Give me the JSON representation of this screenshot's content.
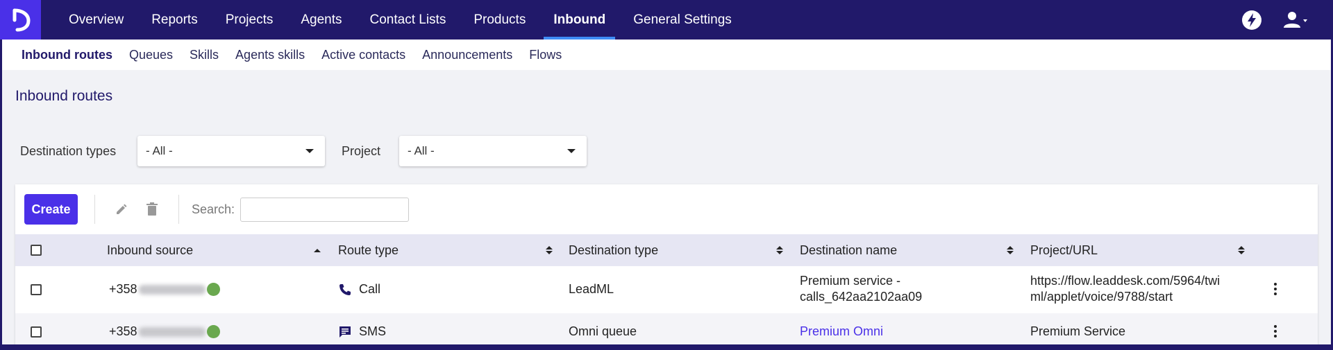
{
  "nav": {
    "logo_icon": "leaddesk-logo-icon",
    "items": [
      {
        "label": "Overview",
        "active": false
      },
      {
        "label": "Reports",
        "active": false
      },
      {
        "label": "Projects",
        "active": false
      },
      {
        "label": "Agents",
        "active": false
      },
      {
        "label": "Contact Lists",
        "active": false
      },
      {
        "label": "Products",
        "active": false
      },
      {
        "label": "Inbound",
        "active": true
      },
      {
        "label": "General Settings",
        "active": false
      }
    ],
    "right_icons": [
      "lightning-icon",
      "user-account-icon"
    ]
  },
  "subnav": {
    "items": [
      {
        "label": "Inbound routes",
        "active": true
      },
      {
        "label": "Queues",
        "active": false
      },
      {
        "label": "Skills",
        "active": false
      },
      {
        "label": "Agents skills",
        "active": false
      },
      {
        "label": "Active contacts",
        "active": false
      },
      {
        "label": "Announcements",
        "active": false
      },
      {
        "label": "Flows",
        "active": false
      }
    ]
  },
  "page": {
    "title": "Inbound routes"
  },
  "filters": {
    "destination_types": {
      "label": "Destination types",
      "value": "- All -"
    },
    "project": {
      "label": "Project",
      "value": "- All -"
    }
  },
  "toolbar": {
    "create_label": "Create",
    "search_label": "Search:",
    "search_value": ""
  },
  "table": {
    "columns": [
      {
        "label": "Inbound source",
        "sort": "asc"
      },
      {
        "label": "Route type",
        "sort": "none"
      },
      {
        "label": "Destination type",
        "sort": "none"
      },
      {
        "label": "Destination name",
        "sort": "none"
      },
      {
        "label": "Project/URL",
        "sort": "none"
      }
    ],
    "rows": [
      {
        "source_prefix": "+358",
        "route_type": "Call",
        "route_icon": "phone-icon",
        "destination_type": "LeadML",
        "destination_name_line1": "Premium service -",
        "destination_name_line2": "calls_642aa2102aa09",
        "project_url_line1": "https://flow.leaddesk.com/5964/twi",
        "project_url_line2": "ml/applet/voice/9788/start"
      },
      {
        "source_prefix": "+358",
        "route_type": "SMS",
        "route_icon": "sms-icon",
        "destination_type": "Omni queue",
        "destination_name_line1": "Premium Omni",
        "project_url_line1": "Premium Service"
      }
    ]
  },
  "colors": {
    "nav_bg": "#21196a",
    "accent": "#4a30e8",
    "active_underline": "#3f8cf5"
  }
}
